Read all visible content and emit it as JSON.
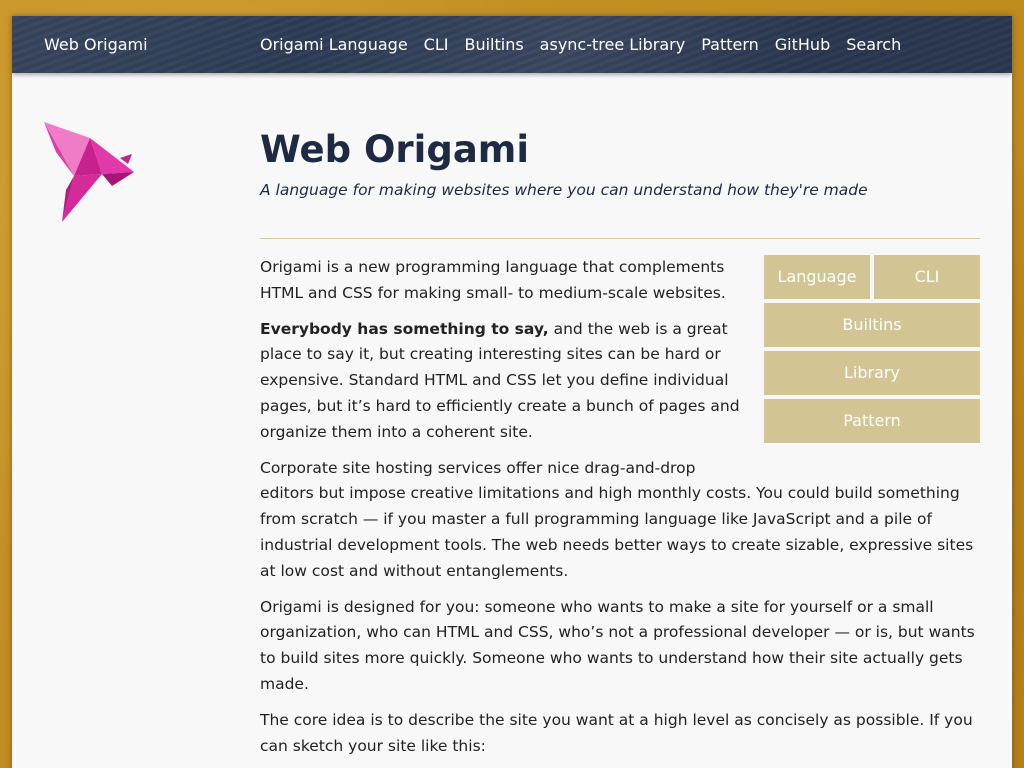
{
  "nav": {
    "site_title": "Web Origami",
    "links": [
      "Origami Language",
      "CLI",
      "Builtins",
      "async-tree Library",
      "Pattern",
      "GitHub",
      "Search"
    ]
  },
  "header": {
    "title": "Web Origami",
    "subtitle": "A language for making websites where you can understand how they're made"
  },
  "quicknav": {
    "language": "Language",
    "cli": "CLI",
    "builtins": "Builtins",
    "library": "Library",
    "pattern": "Pattern"
  },
  "body": {
    "p1": "Origami is a new programming language that complements HTML and CSS for making small- to medium-scale websites.",
    "p2_bold": "Everybody has something to say,",
    "p2_rest": " and the web is a great place to say it, but creating interesting sites can be hard or expensive. Standard HTML and CSS let you define individual pages, but it’s hard to efficiently create a bunch of pages and organize them into a coherent site.",
    "p3": "Corporate site hosting services offer nice drag-and-drop editors but impose creative limitations and high monthly costs. You could build something from scratch — if you master a full programming language like JavaScript and a pile of industrial development tools. The web needs better ways to create sizable, expressive sites at low cost and without entanglements.",
    "p4": "Origami is designed for you: someone who wants to make a site for yourself or a small organization, who can HTML and CSS, who’s not a professional developer — or is, but wants to build sites more quickly. Someone who wants to understand how their site actually gets made.",
    "p5": "The core idea is to describe the site you want at a high level as concisely as possible. If you can sketch your site like this:"
  },
  "logo": {
    "icon": "origami-bird-icon",
    "colors": [
      "#e03aa8",
      "#c8208c",
      "#f07cc8",
      "#a8157a"
    ]
  }
}
